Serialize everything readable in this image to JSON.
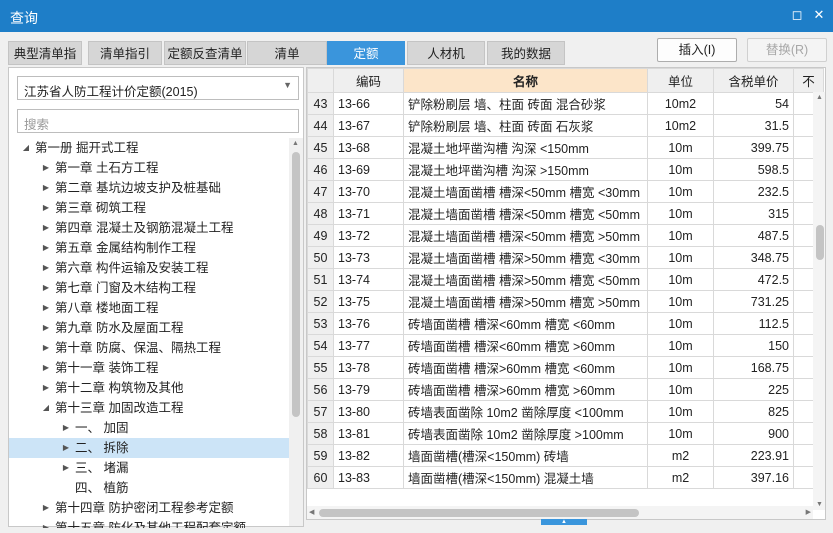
{
  "window": {
    "title": "查询"
  },
  "tabs": [
    {
      "label": "典型清单指引",
      "active": false
    },
    {
      "label": "清单指引",
      "active": false
    },
    {
      "label": "定额反查清单",
      "active": false
    },
    {
      "label": "清单",
      "active": false
    },
    {
      "label": "定额",
      "active": true
    },
    {
      "label": "人材机",
      "active": false
    },
    {
      "label": "我的数据",
      "active": false
    }
  ],
  "actions": {
    "insert_label": "插入(I)",
    "replace_label": "替换(R)"
  },
  "left": {
    "library_select": "江苏省人防工程计价定额(2015)",
    "search_placeholder": "搜索",
    "tree": [
      {
        "label": "第一册 掘开式工程",
        "level": 0,
        "state": "expanded"
      },
      {
        "label": "第一章 土石方工程",
        "level": 1,
        "state": "collapsed"
      },
      {
        "label": "第二章 基坑边坡支护及桩基础",
        "level": 1,
        "state": "collapsed"
      },
      {
        "label": "第三章 砌筑工程",
        "level": 1,
        "state": "collapsed"
      },
      {
        "label": "第四章 混凝土及钢筋混凝土工程",
        "level": 1,
        "state": "collapsed"
      },
      {
        "label": "第五章 金属结构制作工程",
        "level": 1,
        "state": "collapsed"
      },
      {
        "label": "第六章 构件运输及安装工程",
        "level": 1,
        "state": "collapsed"
      },
      {
        "label": "第七章 门窗及木结构工程",
        "level": 1,
        "state": "collapsed"
      },
      {
        "label": "第八章 楼地面工程",
        "level": 1,
        "state": "collapsed"
      },
      {
        "label": "第九章 防水及屋面工程",
        "level": 1,
        "state": "collapsed"
      },
      {
        "label": "第十章 防腐、保温、隔热工程",
        "level": 1,
        "state": "collapsed"
      },
      {
        "label": "第十一章 装饰工程",
        "level": 1,
        "state": "collapsed"
      },
      {
        "label": "第十二章 构筑物及其他",
        "level": 1,
        "state": "collapsed"
      },
      {
        "label": "第十三章 加固改造工程",
        "level": 1,
        "state": "expanded"
      },
      {
        "label": "一、 加固",
        "level": 2,
        "state": "collapsed"
      },
      {
        "label": "二、 拆除",
        "level": 2,
        "state": "collapsed",
        "selected": true
      },
      {
        "label": "三、 堵漏",
        "level": 2,
        "state": "collapsed"
      },
      {
        "label": "四、 植筋",
        "level": 2,
        "state": "leaf"
      },
      {
        "label": "第十四章 防护密闭工程参考定额",
        "level": 1,
        "state": "collapsed"
      },
      {
        "label": "第十五章 防化及其他工程配套定额",
        "level": 1,
        "state": "collapsed"
      }
    ]
  },
  "table": {
    "columns": [
      "",
      "编码",
      "名称",
      "单位",
      "含税单价",
      "不"
    ],
    "rows": [
      {
        "n": "43",
        "code": "13-66",
        "name": "铲除粉刷层 墙、柱面 砖面 混合砂浆",
        "unit": "10m2",
        "price": "54"
      },
      {
        "n": "44",
        "code": "13-67",
        "name": "铲除粉刷层 墙、柱面 砖面 石灰浆",
        "unit": "10m2",
        "price": "31.5"
      },
      {
        "n": "45",
        "code": "13-68",
        "name": "混凝土地坪凿沟槽 沟深 <150mm",
        "unit": "10m",
        "price": "399.75"
      },
      {
        "n": "46",
        "code": "13-69",
        "name": "混凝土地坪凿沟槽 沟深 >150mm",
        "unit": "10m",
        "price": "598.5"
      },
      {
        "n": "47",
        "code": "13-70",
        "name": "混凝土墙面凿槽 槽深<50mm 槽宽 <30mm",
        "unit": "10m",
        "price": "232.5"
      },
      {
        "n": "48",
        "code": "13-71",
        "name": "混凝土墙面凿槽 槽深<50mm 槽宽 <50mm",
        "unit": "10m",
        "price": "315"
      },
      {
        "n": "49",
        "code": "13-72",
        "name": "混凝土墙面凿槽 槽深<50mm 槽宽 >50mm",
        "unit": "10m",
        "price": "487.5"
      },
      {
        "n": "50",
        "code": "13-73",
        "name": "混凝土墙面凿槽 槽深>50mm 槽宽 <30mm",
        "unit": "10m",
        "price": "348.75"
      },
      {
        "n": "51",
        "code": "13-74",
        "name": "混凝土墙面凿槽 槽深>50mm 槽宽 <50mm",
        "unit": "10m",
        "price": "472.5"
      },
      {
        "n": "52",
        "code": "13-75",
        "name": "混凝土墙面凿槽 槽深>50mm 槽宽 >50mm",
        "unit": "10m",
        "price": "731.25"
      },
      {
        "n": "53",
        "code": "13-76",
        "name": "砖墙面凿槽 槽深<60mm 槽宽 <60mm",
        "unit": "10m",
        "price": "112.5"
      },
      {
        "n": "54",
        "code": "13-77",
        "name": "砖墙面凿槽 槽深<60mm 槽宽 >60mm",
        "unit": "10m",
        "price": "150"
      },
      {
        "n": "55",
        "code": "13-78",
        "name": "砖墙面凿槽 槽深>60mm 槽宽 <60mm",
        "unit": "10m",
        "price": "168.75"
      },
      {
        "n": "56",
        "code": "13-79",
        "name": "砖墙面凿槽 槽深>60mm 槽宽 >60mm",
        "unit": "10m",
        "price": "225"
      },
      {
        "n": "57",
        "code": "13-80",
        "name": "砖墙表面凿除 10m2 凿除厚度 <100mm",
        "unit": "10m",
        "price": "825"
      },
      {
        "n": "58",
        "code": "13-81",
        "name": "砖墙表面凿除 10m2 凿除厚度 >100mm",
        "unit": "10m",
        "price": "900"
      },
      {
        "n": "59",
        "code": "13-82",
        "name": "墙面凿槽(槽深<150mm) 砖墙",
        "unit": "m2",
        "price": "223.91"
      },
      {
        "n": "60",
        "code": "13-83",
        "name": "墙面凿槽(槽深<150mm) 混凝土墙",
        "unit": "m2",
        "price": "397.16"
      }
    ]
  },
  "colors": {
    "title_bar": "#1e7ec8",
    "active_tab": "#3a95dc",
    "header_highlight": "#fce5c9",
    "selection": "#cce4f7"
  },
  "icons": {
    "restore": "restore-icon",
    "close": "close-icon",
    "dropdown": "chevron-down-icon",
    "expand": "triangle-right-icon",
    "collapse": "triangle-down-icon"
  }
}
